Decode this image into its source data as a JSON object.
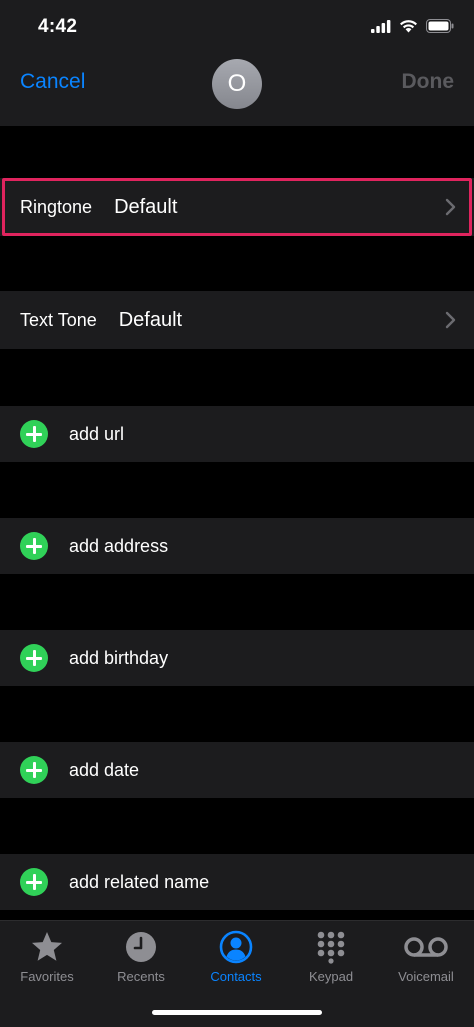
{
  "status": {
    "time": "4:42",
    "icons": [
      "cellular-signal-icon",
      "wifi-icon",
      "battery-icon"
    ]
  },
  "nav": {
    "cancel_label": "Cancel",
    "avatar_initial": "O",
    "done_label": "Done"
  },
  "tones": [
    {
      "label": "Ringtone",
      "value": "Default",
      "highlighted": true
    },
    {
      "label": "Text Tone",
      "value": "Default",
      "highlighted": false
    }
  ],
  "add_fields": [
    "add url",
    "add address",
    "add birthday",
    "add date",
    "add related name"
  ],
  "tabs": [
    {
      "label": "Favorites",
      "icon": "star-icon",
      "active": false
    },
    {
      "label": "Recents",
      "icon": "clock-icon",
      "active": false
    },
    {
      "label": "Contacts",
      "icon": "contact-icon",
      "active": true
    },
    {
      "label": "Keypad",
      "icon": "keypad-icon",
      "active": false
    },
    {
      "label": "Voicemail",
      "icon": "voicemail-icon",
      "active": false
    }
  ],
  "colors": {
    "accent": "#0a84ff",
    "add_green": "#30d158",
    "highlight": "#e0245e",
    "row_bg": "#1c1c1e",
    "inactive": "#8e8e93"
  }
}
